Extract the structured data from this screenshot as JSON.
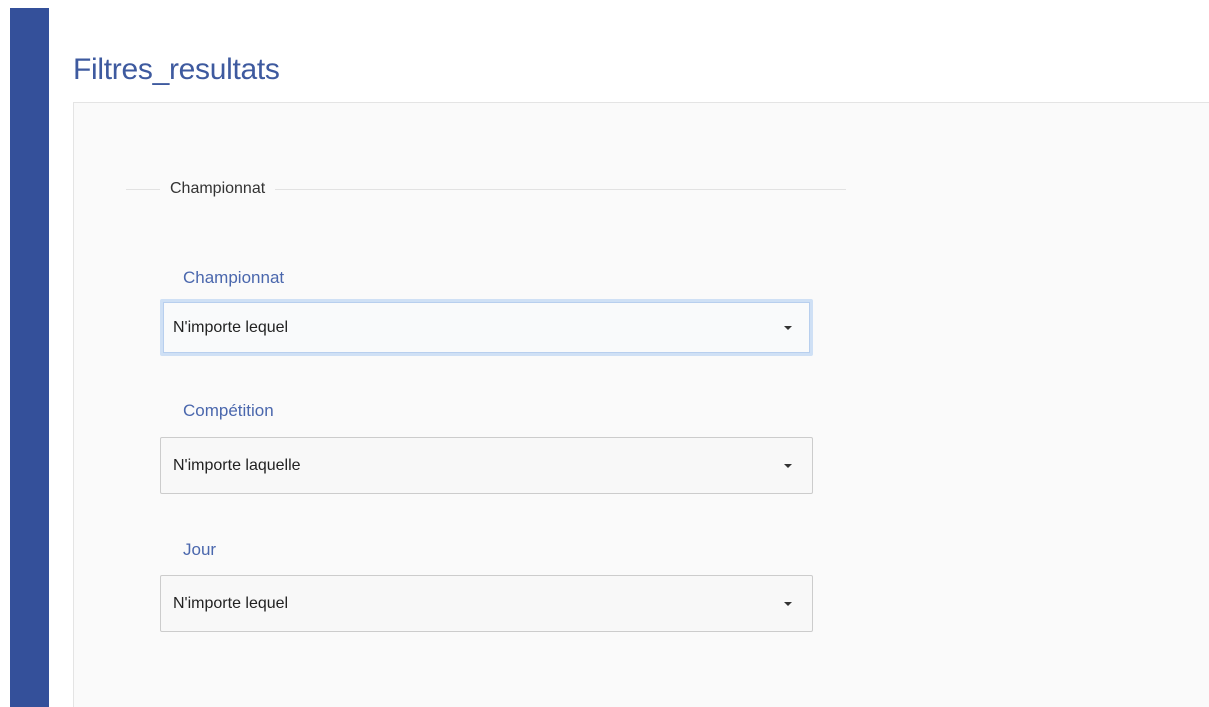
{
  "panel": {
    "title": "Filtres_resultats"
  },
  "fieldset": {
    "legend": "Championnat"
  },
  "fields": [
    {
      "label": "Championnat",
      "selected": "N'importe lequel"
    },
    {
      "label": "Compétition",
      "selected": "N'importe laquelle"
    },
    {
      "label": "Jour",
      "selected": "N'importe lequel"
    }
  ],
  "icons": {
    "dropdown": "caret-down-icon"
  },
  "colors": {
    "sidebar": "#34509a",
    "title": "#3e5a9f",
    "label": "#4a67ad",
    "focus_ring": "#cfe0f5"
  }
}
